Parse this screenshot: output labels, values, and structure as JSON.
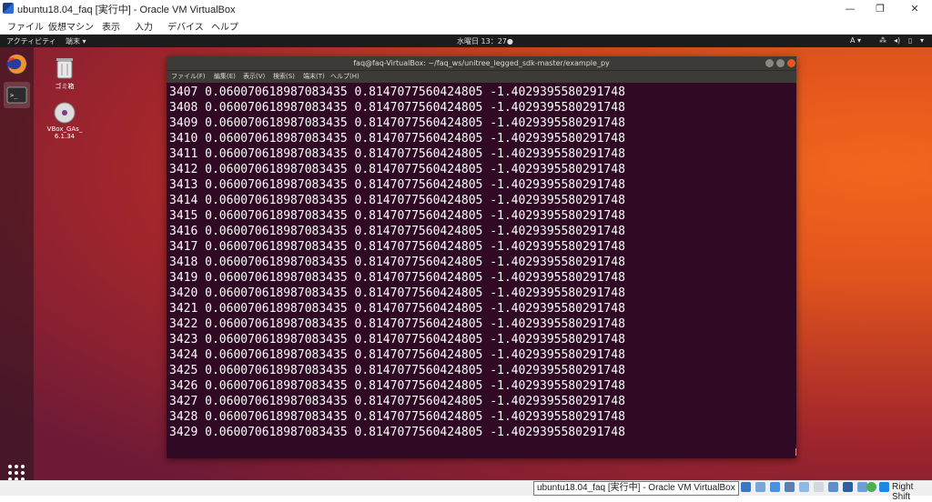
{
  "window": {
    "title": "ubuntu18.04_faq [実行中] - Oracle VM VirtualBox",
    "minimize": "—",
    "maximize": "❐",
    "close": "✕"
  },
  "menu": [
    "ファイル",
    "仮想マシン",
    "表示",
    "入力",
    "デバイス",
    "ヘルプ"
  ],
  "topbar": {
    "activities": "アクティビティ",
    "app": "端末 ▾",
    "clock": "水曜日 13：27●",
    "input": "A ▾"
  },
  "desktop_icons": [
    {
      "label": "ゴミ箱",
      "icon": "trash-icon"
    },
    {
      "label": "VBox_GAs_\n6.1.34",
      "icon": "disc-icon"
    }
  ],
  "terminal": {
    "title": "faq@faq-VirtualBox: ~/faq_ws/unitree_legged_sdk-master/example_py",
    "menu": [
      "ファイル(F)",
      "編集(E)",
      "表示(V)",
      "検索(S)",
      "端末(T)",
      "ヘルプ(H)"
    ],
    "lines": [
      "3407 0.060070618987083435 0.8147077560424805 -1.4029395580291748",
      "3408 0.060070618987083435 0.8147077560424805 -1.4029395580291748",
      "3409 0.060070618987083435 0.8147077560424805 -1.4029395580291748",
      "3410 0.060070618987083435 0.8147077560424805 -1.4029395580291748",
      "3411 0.060070618987083435 0.8147077560424805 -1.4029395580291748",
      "3412 0.060070618987083435 0.8147077560424805 -1.4029395580291748",
      "3413 0.060070618987083435 0.8147077560424805 -1.4029395580291748",
      "3414 0.060070618987083435 0.8147077560424805 -1.4029395580291748",
      "3415 0.060070618987083435 0.8147077560424805 -1.4029395580291748",
      "3416 0.060070618987083435 0.8147077560424805 -1.4029395580291748",
      "3417 0.060070618987083435 0.8147077560424805 -1.4029395580291748",
      "3418 0.060070618987083435 0.8147077560424805 -1.4029395580291748",
      "3419 0.060070618987083435 0.8147077560424805 -1.4029395580291748",
      "3420 0.060070618987083435 0.8147077560424805 -1.4029395580291748",
      "3421 0.060070618987083435 0.8147077560424805 -1.4029395580291748",
      "3422 0.060070618987083435 0.8147077560424805 -1.4029395580291748",
      "3423 0.060070618987083435 0.8147077560424805 -1.4029395580291748",
      "3424 0.060070618987083435 0.8147077560424805 -1.4029395580291748",
      "3425 0.060070618987083435 0.8147077560424805 -1.4029395580291748",
      "3426 0.060070618987083435 0.8147077560424805 -1.4029395580291748",
      "3427 0.060070618987083435 0.8147077560424805 -1.4029395580291748",
      "3428 0.060070618987083435 0.8147077560424805 -1.4029395580291748",
      "3429 0.060070618987083435 0.8147077560424805 -1.4029395580291748"
    ]
  },
  "statusbar": {
    "tooltip": "ubuntu18.04_faq [実行中] - Oracle VM VirtualBox",
    "hostkey": "Right Shift"
  }
}
